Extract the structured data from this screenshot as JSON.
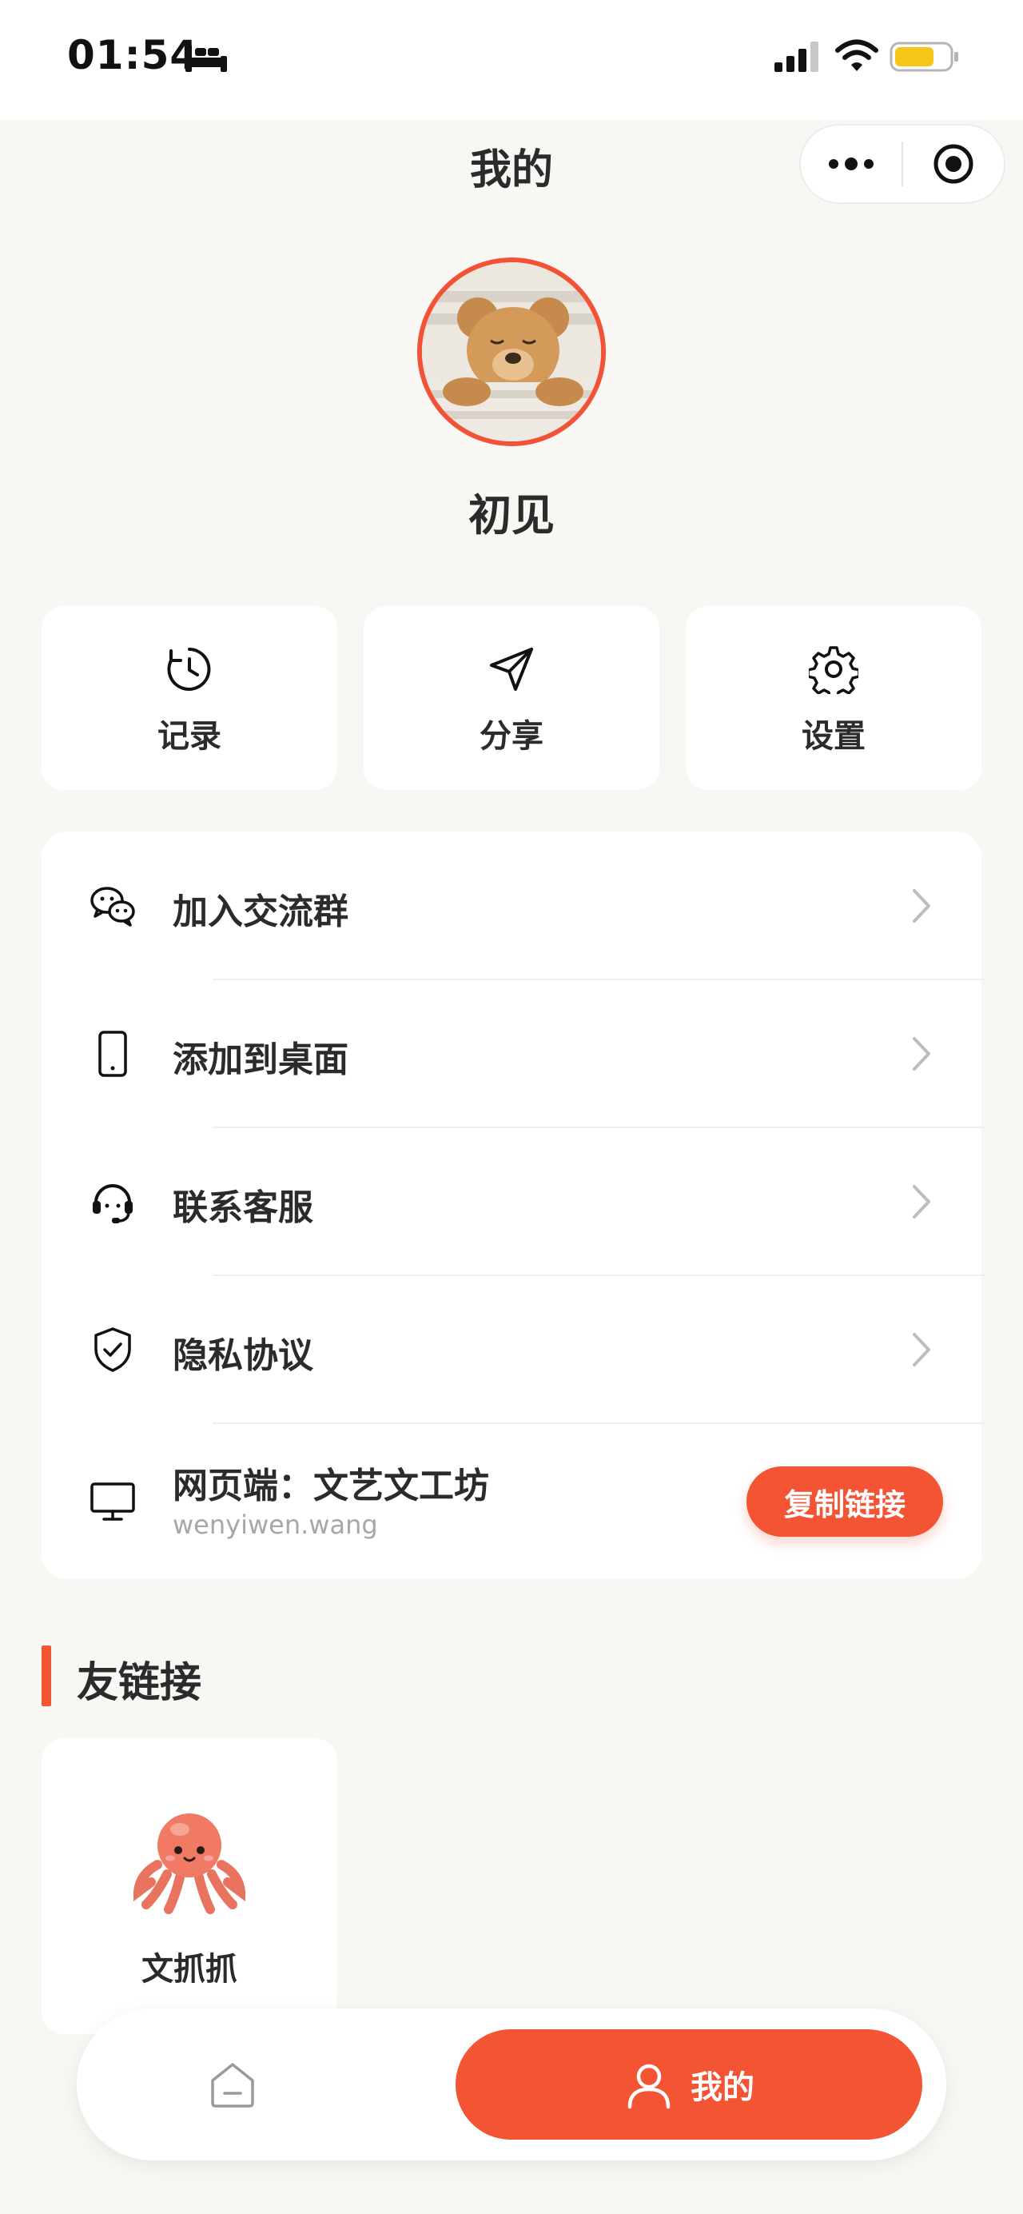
{
  "status_bar": {
    "time": "01:54"
  },
  "nav": {
    "title": "我的"
  },
  "profile": {
    "nickname": "初见"
  },
  "quick_actions": [
    {
      "label": "记录",
      "icon": "history-icon"
    },
    {
      "label": "分享",
      "icon": "send-icon"
    },
    {
      "label": "设置",
      "icon": "gear-icon"
    }
  ],
  "menu": {
    "items": [
      {
        "label": "加入交流群",
        "icon": "wechat-icon"
      },
      {
        "label": "添加到桌面",
        "icon": "phone-icon"
      },
      {
        "label": "联系客服",
        "icon": "headset-icon"
      },
      {
        "label": "隐私协议",
        "icon": "shield-check-icon"
      }
    ],
    "web": {
      "title": "网页端：文艺文工坊",
      "url": "wenyiwen.wang",
      "copy_label": "复制链接",
      "icon": "monitor-icon"
    }
  },
  "friends": {
    "title": "友链接",
    "items": [
      {
        "name": "文抓抓",
        "icon": "octopus-icon"
      }
    ]
  },
  "tab_bar": {
    "home_icon": "home-icon",
    "mine_label": "我的",
    "mine_icon": "user-icon"
  },
  "colors": {
    "accent": "#f35434",
    "background": "#f8f7f3",
    "card": "#ffffff"
  }
}
